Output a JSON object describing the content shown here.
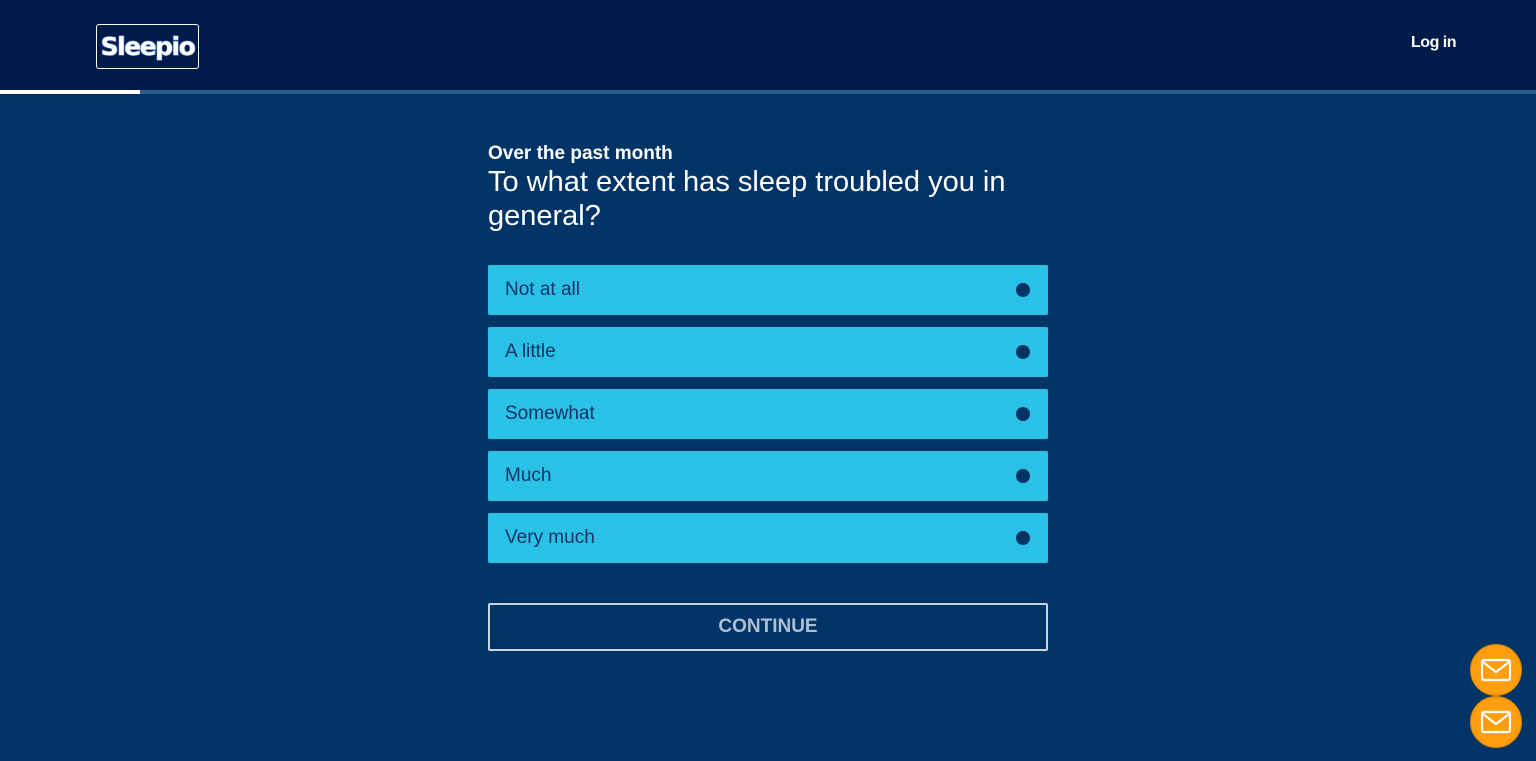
{
  "header": {
    "logo_text": "Sleepio",
    "login_label": "Log in"
  },
  "progress": {
    "fraction": 0.091
  },
  "question": {
    "pre_text": "Over the past month",
    "text": "To what extent has sleep troubled you in general?"
  },
  "options": [
    {
      "label": "Not at all"
    },
    {
      "label": "A little"
    },
    {
      "label": "Somewhat"
    },
    {
      "label": "Much"
    },
    {
      "label": "Very much"
    }
  ],
  "continue_label": "CONTINUE",
  "colors": {
    "header_bg": "#001a4a",
    "page_bg": "#003366",
    "option_bg": "#29c2e6",
    "feedback_button": "#ff9e0f"
  },
  "icons": {
    "feedback_primary": "mail-icon",
    "feedback_secondary": "mail-icon"
  }
}
